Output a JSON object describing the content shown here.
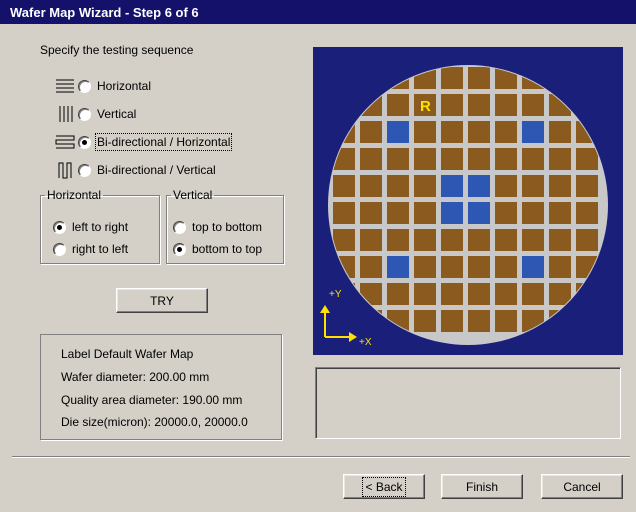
{
  "window": {
    "title": "Wafer Map Wizard  -  Step 6 of 6"
  },
  "sequence": {
    "heading": "Specify the testing sequence",
    "options": [
      {
        "label": "Horizontal",
        "icon": "horizontal-lines-icon",
        "checked": false
      },
      {
        "label": "Vertical",
        "icon": "vertical-lines-icon",
        "checked": false
      },
      {
        "label": "Bi-directional / Horizontal",
        "icon": "bidirectional-horizontal-icon",
        "checked": true
      },
      {
        "label": "Bi-directional / Vertical",
        "icon": "bidirectional-vertical-icon",
        "checked": false
      }
    ]
  },
  "horizontal_group": {
    "legend": "Horizontal",
    "options": [
      {
        "label": "left to right",
        "checked": true
      },
      {
        "label": "right to left",
        "checked": false
      }
    ]
  },
  "vertical_group": {
    "legend": "Vertical",
    "options": [
      {
        "label": "top to bottom",
        "checked": false
      },
      {
        "label": "bottom to top",
        "checked": true
      }
    ]
  },
  "try_button": "TRY",
  "info": {
    "label": "Label  Default Wafer Map",
    "diameter": "Wafer diameter: 200.00 mm",
    "quality": "Quality area diameter: 190.00 mm",
    "die_size": "Die size(micron): 20000.0, 20000.0"
  },
  "preview": {
    "reference_marker": "R",
    "plus_y": "+Y",
    "plus_x": "+X",
    "colors": {
      "background": "#1a1f7a",
      "wafer": "#c8c8c8",
      "die": "#8a5a1e",
      "selected_die": "#2e56b3",
      "marker": "#ffe000"
    },
    "grid": {
      "rows": 10,
      "cols": 10
    },
    "selected_dies": [
      [
        2,
        2
      ],
      [
        2,
        7
      ],
      [
        4,
        4
      ],
      [
        4,
        5
      ],
      [
        5,
        4
      ],
      [
        5,
        5
      ],
      [
        7,
        2
      ],
      [
        7,
        7
      ]
    ],
    "reference_die": [
      1,
      3
    ]
  },
  "buttons": {
    "back": "< Back",
    "finish": "Finish",
    "cancel": "Cancel"
  }
}
